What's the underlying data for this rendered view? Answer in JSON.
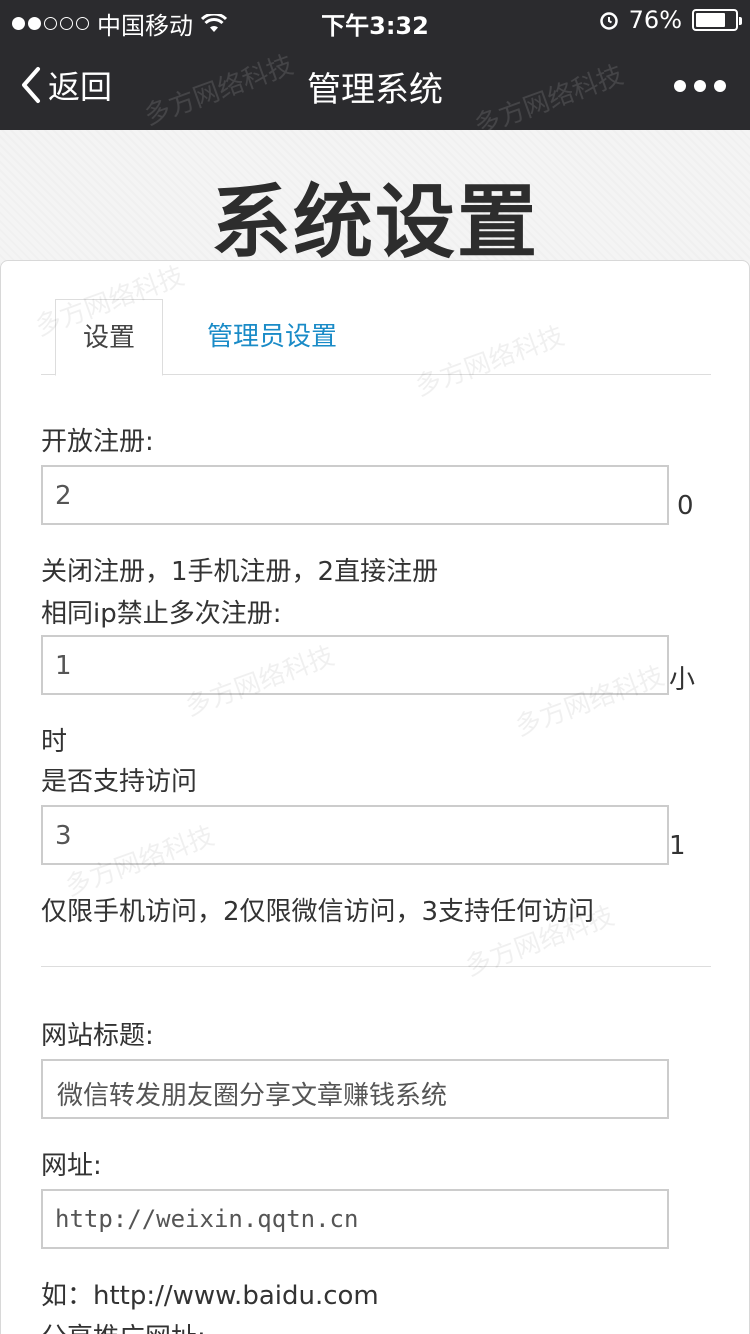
{
  "status_bar": {
    "carrier": "中国移动",
    "time": "下午3:32",
    "battery_percent": "76%",
    "battery_level": 0.76
  },
  "nav": {
    "back_label": "返回",
    "title": "管理系统"
  },
  "page": {
    "title": "系统设置"
  },
  "tabs": {
    "active": "设置",
    "other": "管理员设置"
  },
  "form": {
    "open_register": {
      "label": "开放注册:",
      "value": "2",
      "suffix": "0",
      "hint": "关闭注册，1手机注册，2直接注册"
    },
    "same_ip": {
      "label": "相同ip禁止多次注册:",
      "value": "1",
      "suffix": "小",
      "suffix_wrap": "时"
    },
    "access": {
      "label": "是否支持访问",
      "value": "3",
      "suffix": "1",
      "hint": "仅限手机访问，2仅限微信访问，3支持任何访问"
    },
    "site_title": {
      "label": "网站标题:",
      "value": "微信转发朋友圈分享文章赚钱系统"
    },
    "site_url": {
      "label": "网址:",
      "value": "http://weixin.qqtn.cn",
      "hint": "如：http://www.baidu.com"
    },
    "share_url": {
      "label": "分享推广网址:"
    }
  },
  "watermark_text": "多方网络科技",
  "icons": {
    "back": "chevron-left-icon",
    "more": "more-dots-icon",
    "wifi": "wifi-icon",
    "alarm": "alarm-icon",
    "battery": "battery-icon"
  }
}
